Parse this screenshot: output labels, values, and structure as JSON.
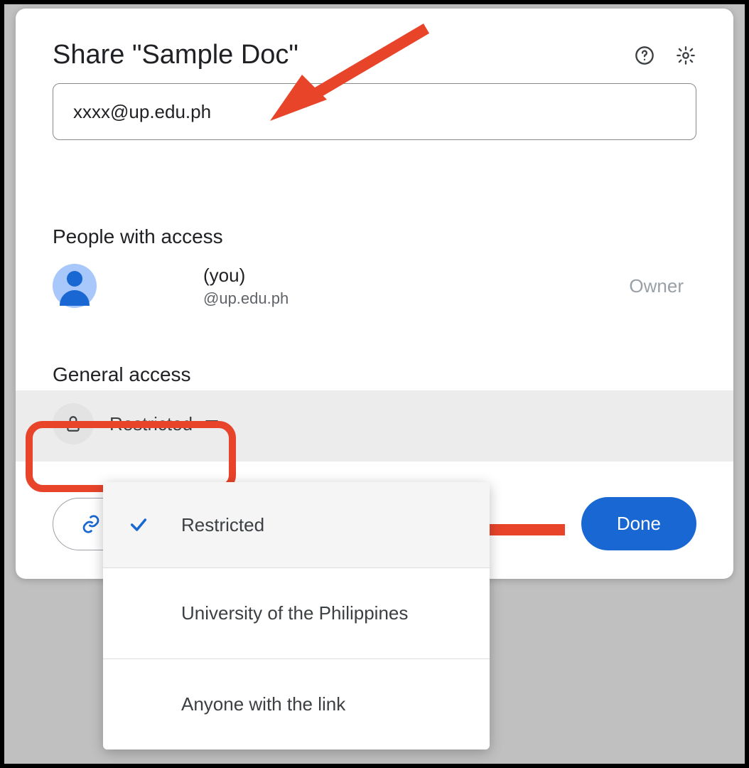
{
  "dialog": {
    "title": "Share \"Sample Doc\"",
    "email_input_value": "xxxx@up.edu.ph"
  },
  "people": {
    "section_label": "People with access",
    "owner_suffix": "(you)",
    "owner_email": "@up.edu.ph",
    "owner_role": "Owner"
  },
  "general": {
    "section_label": "General access",
    "selected": "Restricted",
    "options": {
      "restricted": "Restricted",
      "org": "University of the Philippines",
      "anyone": "Anyone with the link"
    }
  },
  "footer": {
    "done_label": "Done"
  },
  "icons": {
    "help": "help-icon",
    "settings": "gear-icon",
    "lock": "lock-icon",
    "link": "link-icon",
    "check": "check-icon",
    "caret": "caret-down-icon"
  },
  "colors": {
    "accent": "#1967d2",
    "annotation": "#e8442a"
  }
}
